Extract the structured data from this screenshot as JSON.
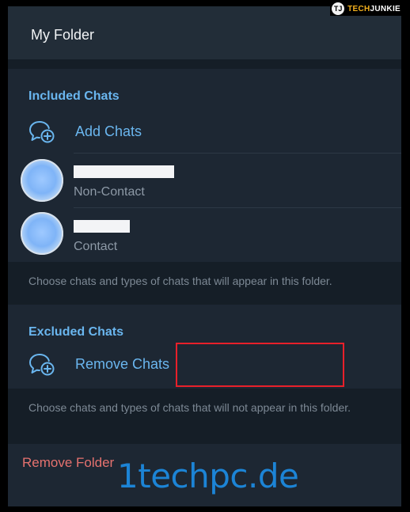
{
  "header": {
    "title": "My Folder"
  },
  "included": {
    "section_title": "Included Chats",
    "add_label": "Add Chats",
    "chats": [
      {
        "name": "",
        "subtitle": "Non-Contact"
      },
      {
        "name": "",
        "subtitle": "Contact"
      }
    ],
    "hint": "Choose chats and types of chats that will appear in this folder."
  },
  "excluded": {
    "section_title": "Excluded Chats",
    "remove_label": "Remove Chats",
    "hint": "Choose chats and types of chats that will not appear in this folder."
  },
  "remove_folder_label": "Remove Folder",
  "logo": {
    "badge": "TJ",
    "brand_part1": "TECH",
    "brand_part2": "JUNKIE"
  },
  "watermark": "1techpc.de",
  "colors": {
    "accent": "#6ab6ef",
    "danger": "#e6726f",
    "highlight": "#e8202a",
    "background": "#1d2733"
  }
}
